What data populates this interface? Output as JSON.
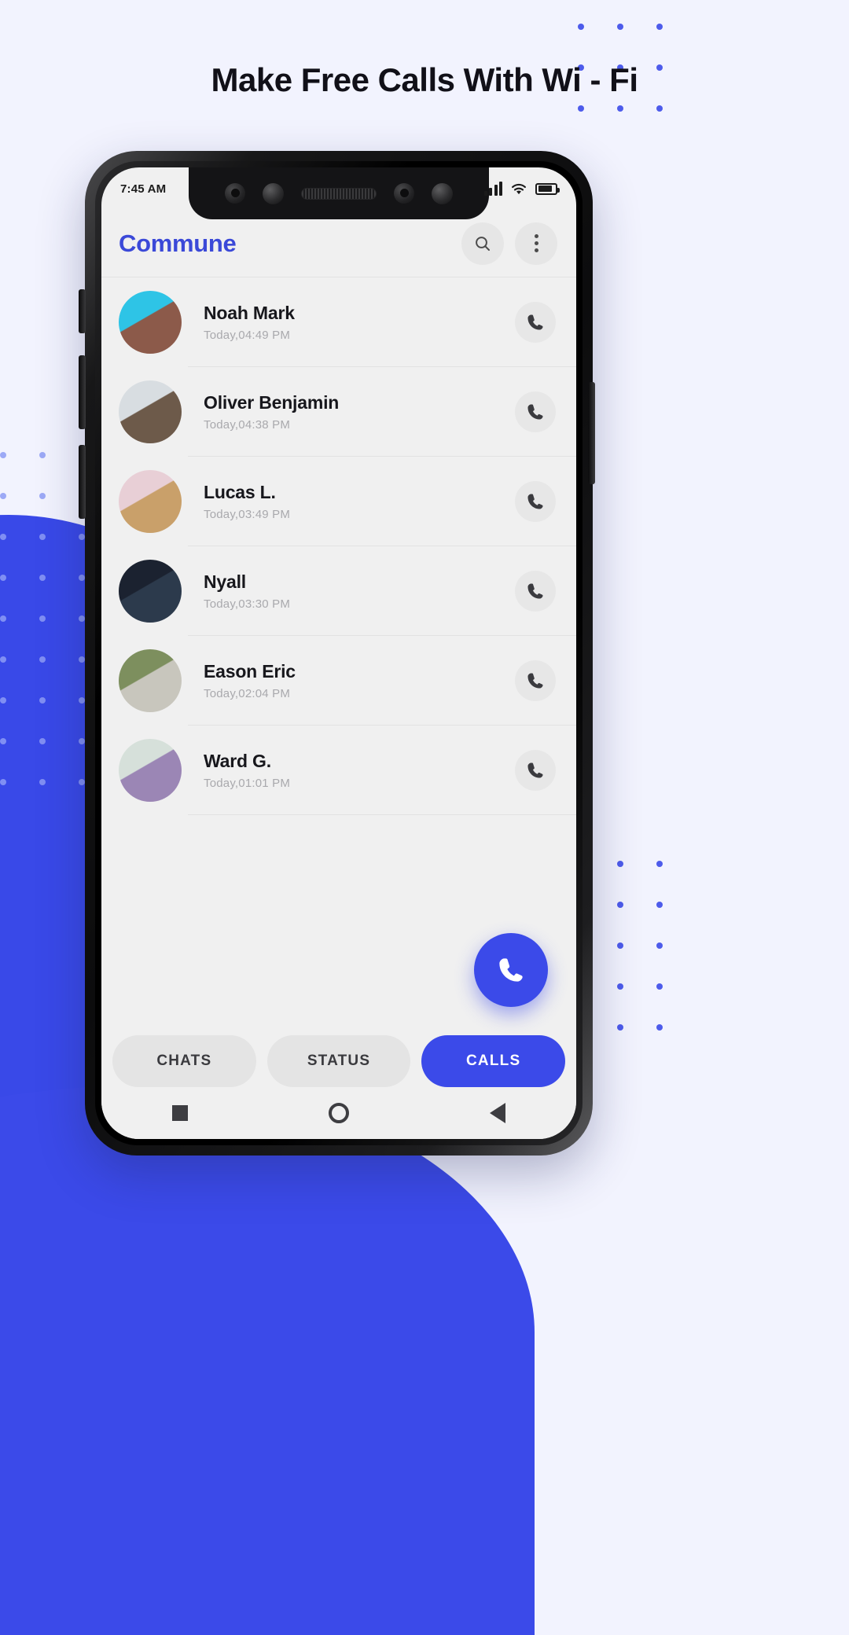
{
  "headline": "Make Free Calls With Wi - Fi",
  "theme": {
    "page_bg": "#f2f3fe",
    "accent": "#3b4ae9",
    "title_blue": "#3b49d8",
    "screen_bg": "#f0f0f0"
  },
  "status_bar": {
    "time": "7:45 AM",
    "signal_icon": "signal-bars-icon",
    "wifi_icon": "wifi-icon",
    "battery_icon": "battery-icon"
  },
  "app_bar": {
    "title": "Commune",
    "search_icon": "search-icon",
    "overflow_icon": "more-vertical-icon"
  },
  "calls": [
    {
      "name": "Noah Mark",
      "time": "Today,04:49 PM",
      "avatar_bg1": "#2ec4e6",
      "avatar_bg2": "#8c5a4a",
      "action_icon": "phone-icon"
    },
    {
      "name": "Oliver Benjamin",
      "time": "Today,04:38 PM",
      "avatar_bg1": "#d8dde1",
      "avatar_bg2": "#6d5a4a",
      "action_icon": "phone-icon"
    },
    {
      "name": "Lucas L.",
      "time": "Today,03:49 PM",
      "avatar_bg1": "#e8cfd6",
      "avatar_bg2": "#c9a06a",
      "action_icon": "phone-icon"
    },
    {
      "name": "Nyall",
      "time": "Today,03:30 PM",
      "avatar_bg1": "#1b2230",
      "avatar_bg2": "#2c3a4c",
      "action_icon": "phone-icon"
    },
    {
      "name": "Eason Eric",
      "time": "Today,02:04 PM",
      "avatar_bg1": "#7d8f5e",
      "avatar_bg2": "#c8c6bd",
      "action_icon": "phone-icon"
    },
    {
      "name": "Ward G.",
      "time": "Today,01:01 PM",
      "avatar_bg1": "#d6e0da",
      "avatar_bg2": "#9b86b5",
      "action_icon": "phone-icon"
    }
  ],
  "fab": {
    "icon": "phone-icon"
  },
  "tabs": [
    {
      "label": "CHATS",
      "active": false
    },
    {
      "label": "STATUS",
      "active": false
    },
    {
      "label": "CALLS",
      "active": true
    }
  ],
  "nav_bar": {
    "recent_icon": "square-icon",
    "home_icon": "circle-icon",
    "back_icon": "triangle-back-icon"
  }
}
